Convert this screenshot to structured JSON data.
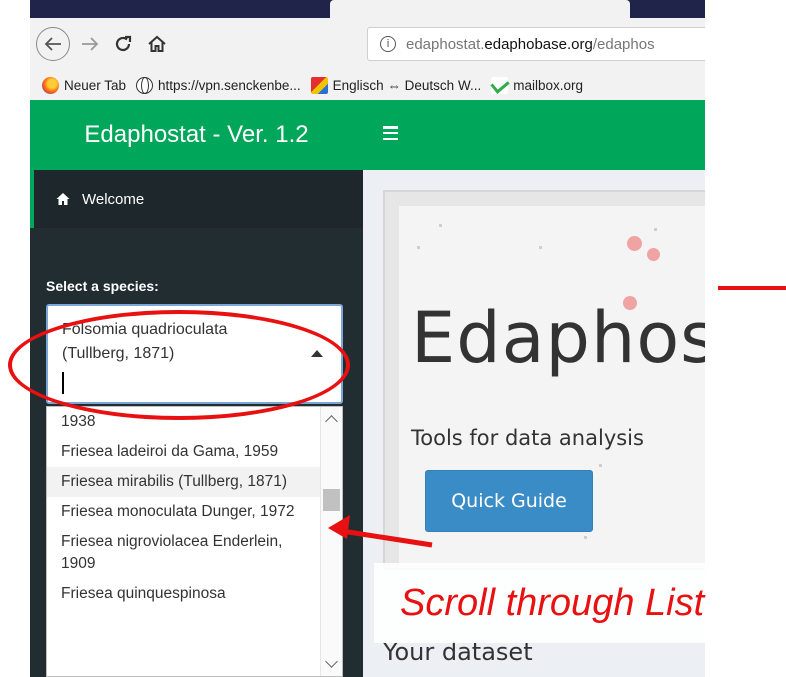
{
  "browser": {
    "url_prefix": "edaphostat.",
    "url_domain": "edaphobase.org",
    "url_suffix": "/edaphos",
    "bookmarks": [
      {
        "label": "Neuer Tab",
        "icon": "firefox-icon"
      },
      {
        "label": "https://vpn.senckenbe...",
        "icon": "globe-icon"
      },
      {
        "label": "Englisch ⇔ Deutsch W...",
        "icon": "dictionary-icon"
      },
      {
        "label": "mailbox.org",
        "icon": "mail-icon"
      }
    ]
  },
  "app": {
    "brand": "Edaphostat - Ver. 1.2",
    "accent_color": "#00a65a",
    "sidebar": {
      "welcome_label": "Welcome",
      "select_label": "Select a species:",
      "selected_value": "Folsomia quadrioculata (Tullberg, 1871)",
      "options": [
        "1938",
        "Friesea ladeiroi da Gama, 1959",
        "Friesea mirabilis (Tullberg, 1871)",
        "Friesea monoculata Dunger, 1972",
        "Friesea nigroviolacea Enderlein, 1909",
        "Friesea quinquespinosa"
      ]
    },
    "main": {
      "title": "Edaphos",
      "subtitle": "Tools for data analysis",
      "quick_guide_label": "Quick Guide",
      "dataset_heading": "Your dataset"
    }
  },
  "annotation": {
    "caption": "Scroll through List",
    "color": "#e81010"
  }
}
